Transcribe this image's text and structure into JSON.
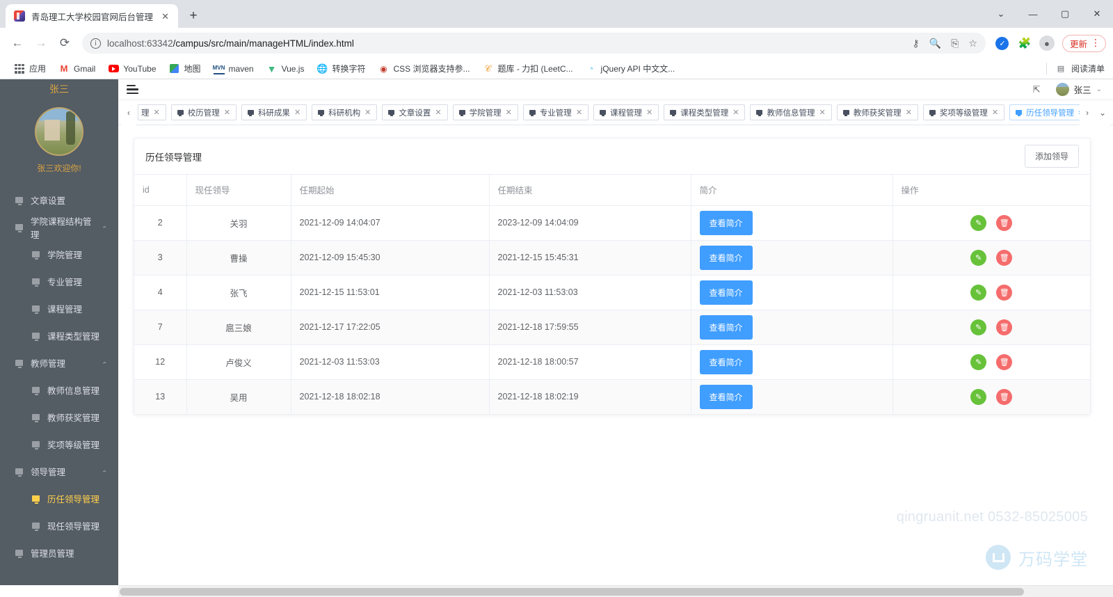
{
  "browser": {
    "tab": {
      "title": "青岛理工大学校园官网后台管理",
      "close": "✕",
      "favicon": "app-favicon"
    },
    "new_tab": "+",
    "window_controls": {
      "minimize": "—",
      "maximize": "▢",
      "close": "✕",
      "more": "⌄"
    },
    "nav": {
      "back": "←",
      "forward": "→",
      "reload": "⟳"
    },
    "omnibox": {
      "info_icon": "ⓘ",
      "host": "localhost:63342",
      "path": "/campus/src/main/manageHTML/index.html",
      "icons": [
        "key-icon",
        "search-icon",
        "share-icon",
        "star-icon"
      ]
    },
    "toolbar_icons": [
      "sync-check-icon",
      "extensions-icon",
      "profile-icon"
    ],
    "update": {
      "label": "更新",
      "kebab": "⋮"
    },
    "bookmarks": [
      {
        "label": "应用",
        "icon": "apps-grid-icon"
      },
      {
        "label": "Gmail",
        "icon": "gmail-icon"
      },
      {
        "label": "YouTube",
        "icon": "youtube-icon"
      },
      {
        "label": "地图",
        "icon": "maps-icon"
      },
      {
        "label": "maven",
        "icon": "maven-icon"
      },
      {
        "label": "Vue.js",
        "icon": "vuejs-icon"
      },
      {
        "label": "转换字符",
        "icon": "globe-icon"
      },
      {
        "label": "CSS 浏览器支持参...",
        "icon": "caniuse-icon"
      },
      {
        "label": "题库 - 力扣 (LeetC...",
        "icon": "leetcode-icon"
      },
      {
        "label": "jQuery API 中文文...",
        "icon": "jquery-icon"
      }
    ],
    "reading_list": {
      "label": "阅读清单",
      "icon": "reading-list-icon"
    }
  },
  "app": {
    "sidebar": {
      "user_top": "张三",
      "greeting": "张三欢迎你!",
      "items": [
        {
          "label": "文章设置",
          "level": 1,
          "active": false,
          "expandable": false
        },
        {
          "label": "学院课程结构管理",
          "level": 1,
          "active": false,
          "expandable": true
        },
        {
          "label": "学院管理",
          "level": 2,
          "active": false,
          "expandable": false
        },
        {
          "label": "专业管理",
          "level": 2,
          "active": false,
          "expandable": false
        },
        {
          "label": "课程管理",
          "level": 2,
          "active": false,
          "expandable": false
        },
        {
          "label": "课程类型管理",
          "level": 2,
          "active": false,
          "expandable": false
        },
        {
          "label": "教师管理",
          "level": 1,
          "active": false,
          "expandable": true
        },
        {
          "label": "教师信息管理",
          "level": 2,
          "active": false,
          "expandable": false
        },
        {
          "label": "教师获奖管理",
          "level": 2,
          "active": false,
          "expandable": false
        },
        {
          "label": "奖项等级管理",
          "level": 2,
          "active": false,
          "expandable": false
        },
        {
          "label": "领导管理",
          "level": 1,
          "active": false,
          "expandable": true
        },
        {
          "label": "历任领导管理",
          "level": 2,
          "active": true,
          "expandable": false
        },
        {
          "label": "现任领导管理",
          "level": 2,
          "active": false,
          "expandable": false
        },
        {
          "label": "管理员管理",
          "level": 1,
          "active": false,
          "expandable": false
        }
      ]
    },
    "header": {
      "user_name": "张三",
      "chevron": "⌄",
      "pin_icon": "pin-icon"
    },
    "tagbar": {
      "left_arrow": "‹",
      "right_arrow": "›",
      "dropdown": "⌄",
      "tags": [
        {
          "label": "理",
          "active": false
        },
        {
          "label": "校历管理",
          "active": false
        },
        {
          "label": "科研成果",
          "active": false
        },
        {
          "label": "科研机构",
          "active": false
        },
        {
          "label": "文章设置",
          "active": false
        },
        {
          "label": "学院管理",
          "active": false
        },
        {
          "label": "专业管理",
          "active": false
        },
        {
          "label": "课程管理",
          "active": false
        },
        {
          "label": "课程类型管理",
          "active": false
        },
        {
          "label": "教师信息管理",
          "active": false
        },
        {
          "label": "教师获奖管理",
          "active": false
        },
        {
          "label": "奖项等级管理",
          "active": false
        },
        {
          "label": "历任领导管理",
          "active": true
        }
      ],
      "close_glyph": "✕"
    },
    "page": {
      "title": "历任领导管理",
      "add_button": "添加领导",
      "table": {
        "columns": [
          "id",
          "现任领导",
          "任期起始",
          "任期结束",
          "简介",
          "操作"
        ],
        "view_button": "查看简介",
        "edit_icon": "pencil-icon",
        "delete_icon": "trash-icon",
        "rows": [
          {
            "id": "2",
            "name": "关羽",
            "start": "2021-12-09 14:04:07",
            "end": "2023-12-09 14:04:09"
          },
          {
            "id": "3",
            "name": "曹操",
            "start": "2021-12-09 15:45:30",
            "end": "2021-12-15 15:45:31"
          },
          {
            "id": "4",
            "name": "张飞",
            "start": "2021-12-15 11:53:01",
            "end": "2021-12-03 11:53:03"
          },
          {
            "id": "7",
            "name": "扈三娘",
            "start": "2021-12-17 17:22:05",
            "end": "2021-12-18 17:59:55"
          },
          {
            "id": "12",
            "name": "卢俊义",
            "start": "2021-12-03 11:53:03",
            "end": "2021-12-18 18:00:57"
          },
          {
            "id": "13",
            "name": "吴用",
            "start": "2021-12-18 18:02:18",
            "end": "2021-12-18 18:02:19"
          }
        ]
      }
    },
    "watermark": {
      "text": "qingruanit.net 0532-85025005",
      "brand": "万码学堂"
    }
  },
  "colors": {
    "primary": "#409eff",
    "success": "#67c23a",
    "danger": "#f56c6c",
    "sidebar_bg": "#545c64",
    "sidebar_active": "#ffd04b",
    "update_red": "#d93025"
  }
}
